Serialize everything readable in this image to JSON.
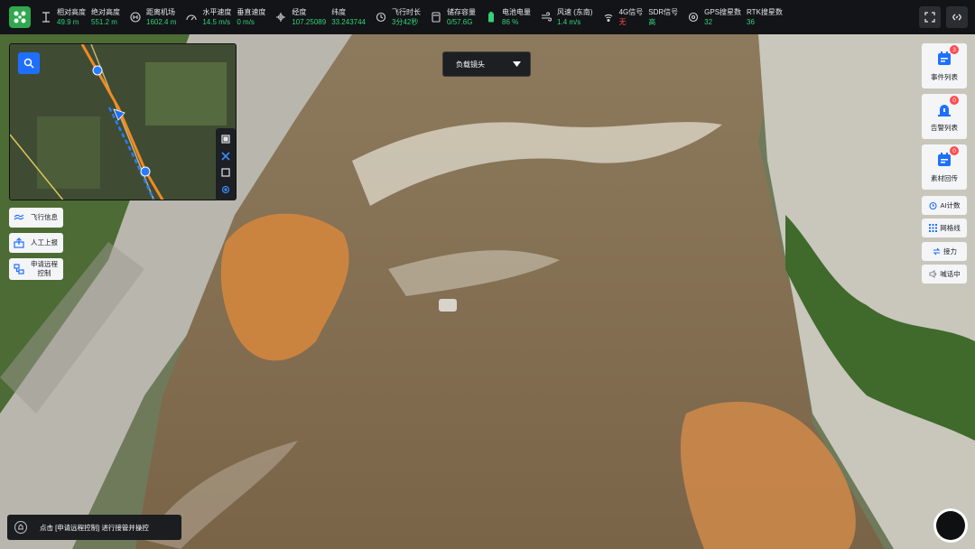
{
  "telemetry": [
    {
      "icon": "altitude-icon",
      "labels": [
        "相对高度",
        "绝对高度"
      ],
      "values": [
        "49.9 m",
        "551.2 m"
      ]
    },
    {
      "icon": "home-distance-icon",
      "labels": [
        "距离机场"
      ],
      "values": [
        "1602.4 m"
      ]
    },
    {
      "icon": "speed-icon",
      "labels": [
        "水平速度",
        "垂直速度"
      ],
      "values": [
        "14.5 m/s",
        "0 m/s"
      ]
    },
    {
      "icon": "coordinate-icon",
      "labels": [
        "经度",
        "纬度"
      ],
      "values": [
        "107.25089",
        "33.243744"
      ]
    },
    {
      "icon": "flight-time-icon",
      "labels": [
        "飞行时长"
      ],
      "values": [
        "3分42秒"
      ]
    },
    {
      "icon": "storage-icon",
      "labels": [
        "储存容量"
      ],
      "values": [
        "0/57.6G"
      ]
    },
    {
      "icon": "battery-icon",
      "labels": [
        "电池电量"
      ],
      "values": [
        "86 %"
      ]
    },
    {
      "icon": "wind-icon",
      "labels": [
        "风速 (东南)"
      ],
      "values": [
        "1.4 m/s"
      ]
    },
    {
      "icon": "signal-icon",
      "labels": [
        "4G信号",
        "SDR信号"
      ],
      "values": [
        "无",
        "高"
      ],
      "warn": [
        true,
        false
      ]
    },
    {
      "icon": "gps-icon",
      "labels": [
        "GPS搜星数",
        "RTK搜星数"
      ],
      "values": [
        "32",
        "36"
      ]
    }
  ],
  "payload_dropdown": {
    "label": "负载镜头"
  },
  "left_buttons": {
    "flight_info": "飞行信息",
    "manual_report": "人工上报",
    "remote_control": "申请远程控制"
  },
  "right_panel": {
    "event_list": {
      "label": "事件列表",
      "badge": "3"
    },
    "alarm_list": {
      "label": "告警列表",
      "badge": "0"
    },
    "media_return": {
      "label": "素材回传",
      "badge": "0"
    },
    "ai_count": "AI计数",
    "grid": "网格线",
    "relay": "接力",
    "shouting": "喊话中"
  },
  "hint_bar": {
    "text": "点击 [申请远程控制] 进行接管并操控"
  },
  "colors": {
    "accent_green": "#33d17a",
    "warn_red": "#ff4d4f",
    "primary_blue": "#1f6fff"
  }
}
